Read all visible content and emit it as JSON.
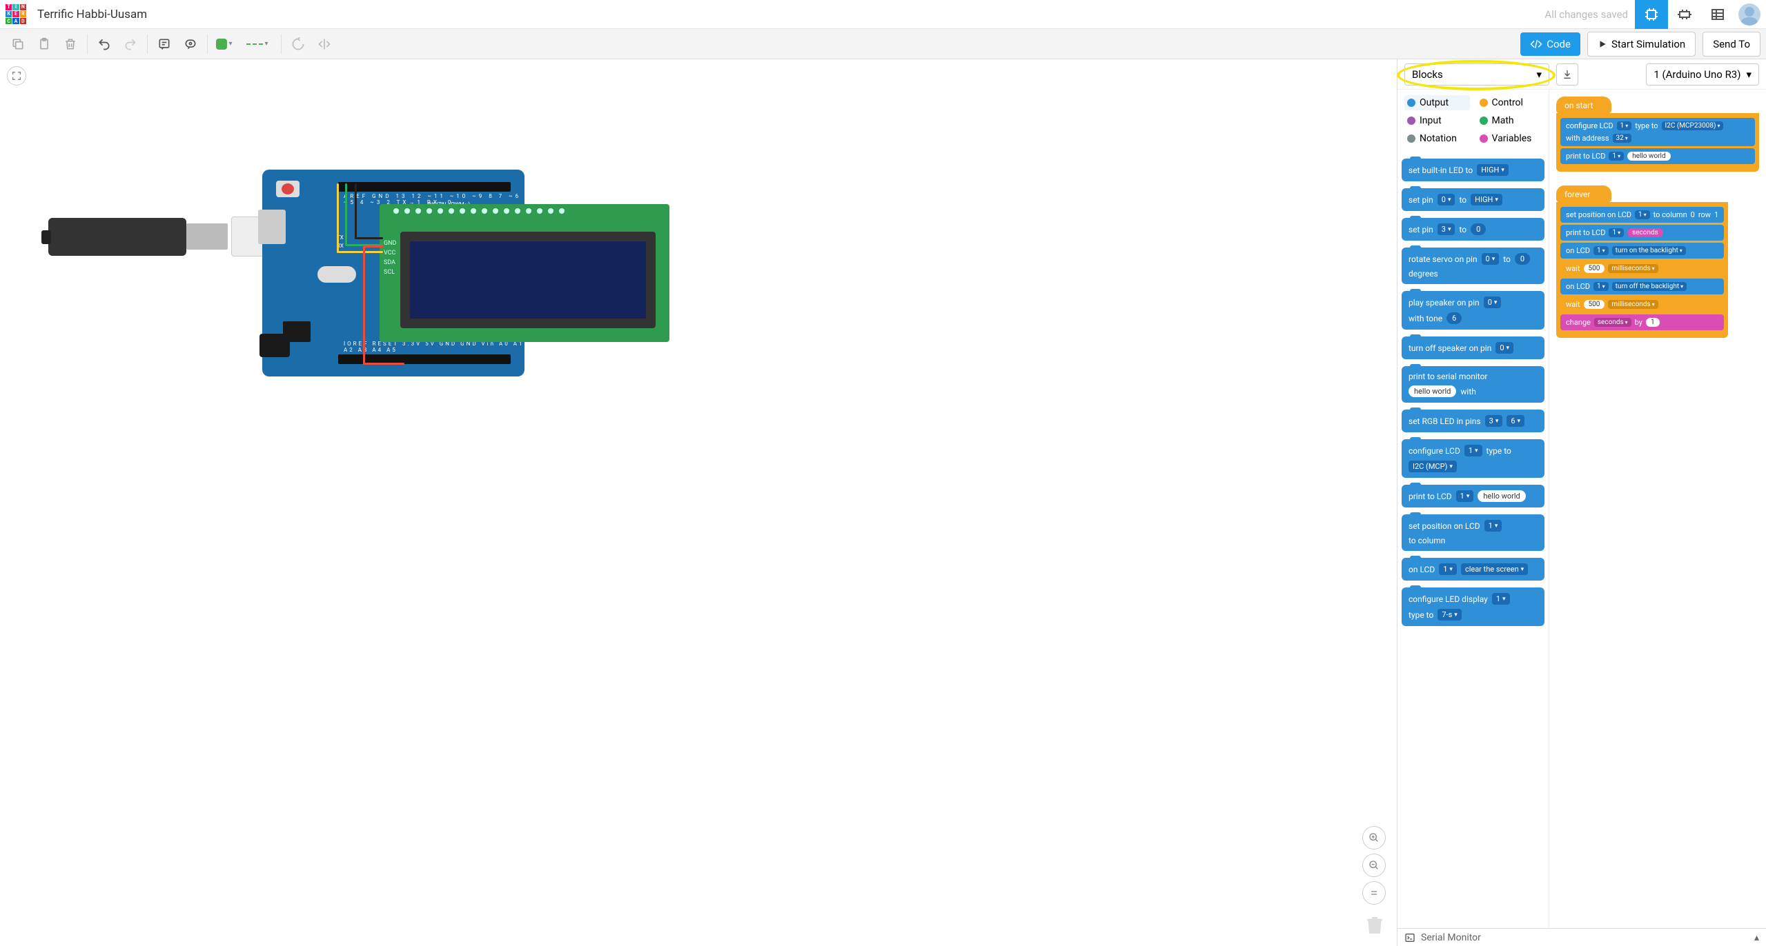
{
  "header": {
    "project_title": "Terrific Habbi-Uusam",
    "save_status": "All changes saved"
  },
  "toolbar": {
    "code_label": "Code",
    "start_sim_label": "Start Simulation",
    "send_to_label": "Send To"
  },
  "code_panel": {
    "mode_dropdown": "Blocks",
    "board_dropdown": "1 (Arduino Uno R3)",
    "categories": [
      {
        "name": "Output",
        "color": "#2f8fd7",
        "selected": true
      },
      {
        "name": "Control",
        "color": "#f5a623"
      },
      {
        "name": "Input",
        "color": "#9b59b6"
      },
      {
        "name": "Math",
        "color": "#27ae60"
      },
      {
        "name": "Notation",
        "color": "#7f8c8d"
      },
      {
        "name": "Variables",
        "color": "#d94db4"
      }
    ],
    "palette_blocks": [
      {
        "parts": [
          "set built-in LED to",
          {
            "dd": "HIGH"
          }
        ]
      },
      {
        "parts": [
          "set pin",
          {
            "dd": "0"
          },
          "to",
          {
            "dd": "HIGH"
          }
        ]
      },
      {
        "parts": [
          "set pin",
          {
            "dd": "3"
          },
          "to",
          {
            "oval": "0"
          }
        ]
      },
      {
        "parts": [
          "rotate servo on pin",
          {
            "dd": "0"
          },
          "to",
          {
            "oval": "0"
          },
          "degrees"
        ]
      },
      {
        "parts": [
          "play speaker on pin",
          {
            "dd": "0"
          },
          "with tone",
          {
            "oval": "6"
          }
        ]
      },
      {
        "parts": [
          "turn off speaker on pin",
          {
            "dd": "0"
          }
        ]
      },
      {
        "parts": [
          "print to serial monitor",
          {
            "pill": "hello world"
          },
          "with"
        ]
      },
      {
        "parts": [
          "set RGB LED in pins",
          {
            "dd": "3"
          },
          {
            "dd": "6"
          }
        ]
      },
      {
        "parts": [
          "configure LCD",
          {
            "dd": "1"
          },
          "type to",
          {
            "dd": "I2C (MCP)"
          }
        ]
      },
      {
        "parts": [
          "print to LCD",
          {
            "dd": "1"
          },
          {
            "pill": "hello world"
          }
        ]
      },
      {
        "parts": [
          "set position on LCD",
          {
            "dd": "1"
          },
          "to column"
        ]
      },
      {
        "parts": [
          "on LCD",
          {
            "dd": "1"
          },
          {
            "dd": "clear the screen"
          }
        ]
      },
      {
        "parts": [
          "configure LED display",
          {
            "dd": "1"
          },
          "type to",
          {
            "dd": "7-s"
          }
        ]
      }
    ],
    "workspace": {
      "on_start": {
        "hat": "on start",
        "blocks": [
          {
            "color": "blue",
            "parts": [
              "configure LCD",
              {
                "dd": "1"
              },
              "type to",
              {
                "dd": "I2C (MCP23008)"
              },
              "with address",
              {
                "dd": "32"
              }
            ]
          },
          {
            "color": "blue",
            "parts": [
              "print to LCD",
              {
                "dd": "1"
              },
              {
                "pill": "hello world"
              }
            ]
          }
        ]
      },
      "forever": {
        "hat": "forever",
        "blocks": [
          {
            "color": "blue",
            "parts": [
              "set position on LCD",
              {
                "dd": "1"
              },
              "to column",
              {
                "oval": "0"
              },
              "row",
              {
                "oval": "1"
              }
            ]
          },
          {
            "color": "blue",
            "parts": [
              "print to LCD",
              {
                "dd": "1"
              },
              {
                "var": "seconds"
              }
            ]
          },
          {
            "color": "blue",
            "parts": [
              "on LCD",
              {
                "dd": "1"
              },
              {
                "dd": "turn on the backlight"
              }
            ]
          },
          {
            "color": "orange",
            "parts": [
              "wait",
              {
                "pill": "500"
              },
              {
                "dd": "milliseconds"
              }
            ]
          },
          {
            "color": "blue",
            "parts": [
              "on LCD",
              {
                "dd": "1"
              },
              {
                "dd": "turn off the backlight"
              }
            ]
          },
          {
            "color": "orange",
            "parts": [
              "wait",
              {
                "pill": "500"
              },
              {
                "dd": "milliseconds"
              }
            ]
          },
          {
            "color": "magenta",
            "parts": [
              "change",
              {
                "dd": "seconds"
              },
              "by",
              {
                "pill": "1"
              }
            ]
          }
        ]
      }
    },
    "serial_monitor": "Serial Monitor"
  },
  "circuit": {
    "lcd_pin_labels": [
      "GND",
      "VCC",
      "SDA",
      "SCL"
    ],
    "arduino_top_pins": "AREF GND 13 12 ~11 ~10 ~9 8  7 ~6 ~5 4 ~3 2 TX→1 RX←0",
    "arduino_digital_label": "DIGITAL (PWM~)",
    "arduino_bot_pins": "IOREF RESET 3.3V 5V GND GND Vin   A0 A1 A2 A3 A4 A5",
    "arduino_tx": "TX",
    "arduino_rx": "RX"
  }
}
